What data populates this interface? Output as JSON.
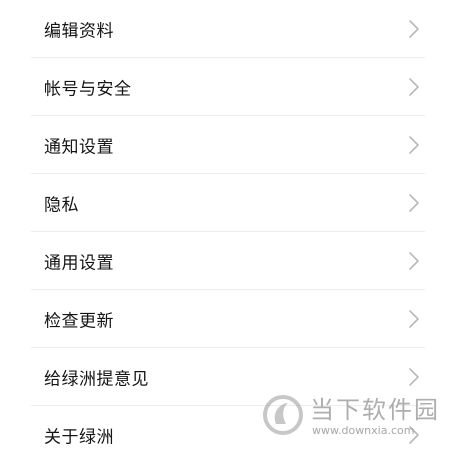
{
  "settings": {
    "items": [
      {
        "label": "编辑资料"
      },
      {
        "label": "帐号与安全"
      },
      {
        "label": "通知设置"
      },
      {
        "label": "隐私"
      },
      {
        "label": "通用设置"
      },
      {
        "label": "检查更新"
      },
      {
        "label": "给绿洲提意见"
      },
      {
        "label": "关于绿洲"
      }
    ]
  },
  "watermark": {
    "name": "当下软件园",
    "url": "www.downxia.com"
  },
  "colors": {
    "text": "#151515",
    "chevron": "#b9b9b9",
    "divider": "#ededed"
  },
  "icons": {
    "row_arrow": "chevron-right-icon",
    "watermark_logo": "downxia-logo-icon"
  }
}
